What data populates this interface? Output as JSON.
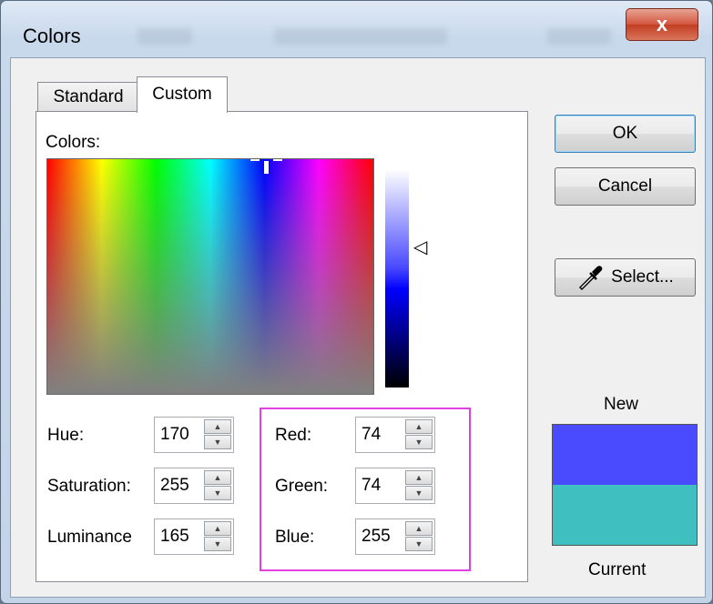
{
  "window": {
    "title": "Colors",
    "close_label": "x"
  },
  "tabs": [
    {
      "label": "Standard",
      "selected": false
    },
    {
      "label": "Custom",
      "selected": true
    }
  ],
  "colors_label": "Colors:",
  "hsl": {
    "hue": {
      "label": "Hue:",
      "value": "170"
    },
    "saturation": {
      "label": "Saturation:",
      "value": "255"
    },
    "luminance": {
      "label": "Luminance",
      "value": "165"
    }
  },
  "rgb": {
    "red": {
      "label": "Red:",
      "value": "74"
    },
    "green": {
      "label": "Green:",
      "value": "74"
    },
    "blue": {
      "label": "Blue:",
      "value": "255"
    }
  },
  "buttons": {
    "ok": "OK",
    "cancel": "Cancel",
    "select": "Select..."
  },
  "preview": {
    "new_label": "New",
    "current_label": "Current",
    "new_color": "#4a4aff",
    "current_color": "#3fbfbf"
  },
  "highlight_color": "#e040e0"
}
